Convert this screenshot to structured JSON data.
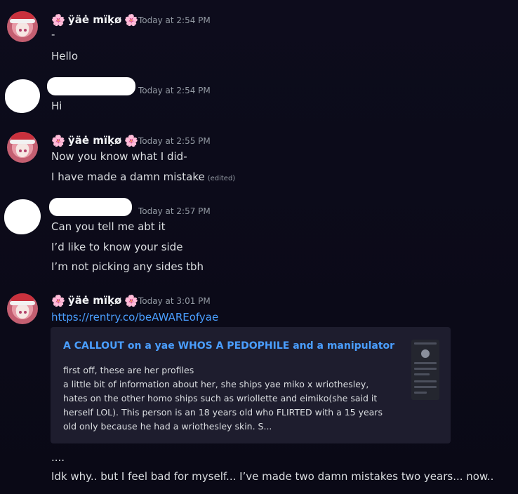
{
  "messages": [
    {
      "author": "ÿäė mïķø",
      "timestamp": "Today at 2:54 PM",
      "lines": [
        "-",
        "Hello"
      ]
    },
    {
      "author": "",
      "timestamp": "Today at 2:54 PM",
      "lines": [
        "Hi"
      ]
    },
    {
      "author": "ÿäė mïķø",
      "timestamp": "Today at 2:55 PM",
      "lines": [
        "Now you know what I did-",
        "I have made a damn mistake"
      ],
      "edited_label": "(edited)"
    },
    {
      "author": "",
      "timestamp": "Today at 2:57 PM",
      "lines": [
        "Can you tell me abt it",
        "I’d like to know your side",
        "I’m not picking any sides tbh"
      ]
    },
    {
      "author": "ÿäė mïķø",
      "timestamp": "Today at 3:01 PM",
      "lines": [
        "https://rentry.co/beAWAREofyae"
      ],
      "embed": {
        "title": "A CALLOUT on a yae WHOS A PEDOPHILE and a manipulator",
        "description": "first off, these are her profiles\na little bit of information about her, she ships yae miko x wriothesley, hates on the other homo ships such as wriollette and eimiko(she said it herself LOL). This person is an 18 years old who FLIRTED with a 15 years old only because he had a wriothesley skin. S..."
      },
      "after_lines": [
        "....",
        "Idk why.. but I feel bad for myself... I’ve made two damn mistakes two years... now.."
      ]
    }
  ],
  "icons": {
    "name_decoration": "cherry-blossom-icon"
  },
  "colors": {
    "background": "#0b0a18",
    "link": "#4a9eff",
    "username": "#f2f3f5",
    "text": "#dbdee1",
    "timestamp": "#949ba4",
    "embed_bg": "#1e1d2e"
  }
}
